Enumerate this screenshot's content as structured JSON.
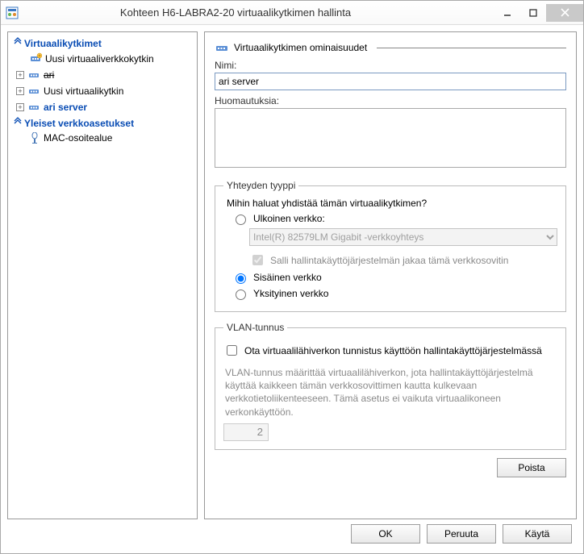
{
  "window": {
    "title": "Kohteen H6-LABRA2-20 virtuaalikytkimen hallinta"
  },
  "sidebar": {
    "section_switches": "Virtuaalikytkimet",
    "section_global": "Yleiset verkkoasetukset",
    "items": [
      {
        "label": "Uusi virtuaaliverkkokytkin"
      },
      {
        "label": "ari"
      },
      {
        "label": "Uusi virtuaalikytkin"
      },
      {
        "label": "ari server"
      }
    ],
    "mac_item": "MAC-osoitealue"
  },
  "props": {
    "heading": "Virtuaalikytkimen ominaisuudet",
    "name_label": "Nimi:",
    "name_value": "ari server",
    "notes_label": "Huomautuksia:",
    "notes_value": ""
  },
  "conn": {
    "legend": "Yhteyden tyyppi",
    "question": "Mihin haluat yhdistää tämän virtuaalikytkimen?",
    "ext_label": "Ulkoinen verkko:",
    "nic_value": "Intel(R) 82579LM Gigabit -verkkoyhteys",
    "share_label": "Salli hallintakäyttöjärjestelmän jakaa tämä verkkosovitin",
    "int_label": "Sisäinen verkko",
    "priv_label": "Yksityinen verkko",
    "selected": "internal"
  },
  "vlan": {
    "legend": "VLAN-tunnus",
    "enable_label": "Ota virtuaalilähiverkon tunnistus käyttöön hallintakäyttöjärjestelmässä",
    "desc": "VLAN-tunnus määrittää virtuaalilähiverkon, jota hallintakäyttöjärjestelmä käyttää kaikkeen tämän verkkosovittimen kautta kulkevaan verkkotietoliikenteeseen. Tämä asetus ei vaikuta virtuaalikoneen verkonkäyttöön.",
    "id_value": "2"
  },
  "buttons": {
    "remove": "Poista",
    "ok": "OK",
    "cancel": "Peruuta",
    "apply": "Käytä"
  }
}
